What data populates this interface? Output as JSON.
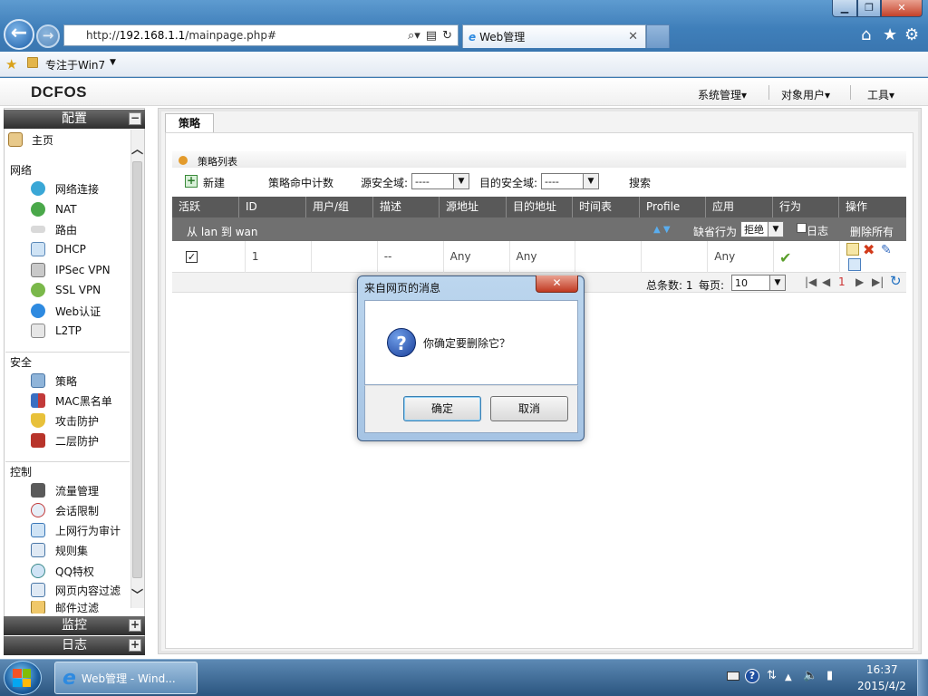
{
  "browser": {
    "address_prefix": "http://",
    "address_host": "192.168.1.1",
    "address_path": "/mainpage.php#",
    "tab_title": "Web管理",
    "favorites_label": "专注于Win7"
  },
  "app": {
    "logo": "DCFOS",
    "menus": [
      "系统管理▾",
      "对象用户▾",
      "工具▾"
    ]
  },
  "sidebar": {
    "config_header": "配置",
    "config_toggle": "−",
    "home": "主页",
    "sections": [
      {
        "title": "网络",
        "items": [
          "网络连接",
          "NAT",
          "路由",
          "DHCP",
          "IPSec VPN",
          "SSL VPN",
          "Web认证",
          "L2TP"
        ]
      },
      {
        "title": "安全",
        "items": [
          "策略",
          "MAC黑名单",
          "攻击防护",
          "二层防护"
        ]
      },
      {
        "title": "控制",
        "items": [
          "流量管理",
          "会话限制",
          "上网行为审计",
          "规则集",
          "QQ特权",
          "网页内容过滤",
          "邮件过滤"
        ]
      }
    ],
    "monitor_header": "监控",
    "log_header": "日志",
    "expand_toggle": "+"
  },
  "content": {
    "tab": "策略",
    "list_title": "策略列表",
    "toolbar": {
      "new_label": "新建",
      "hit_count": "策略命中计数",
      "src_zone_label": "源安全域:",
      "src_zone_value": "----",
      "dst_zone_label": "目的安全域:",
      "dst_zone_value": "----",
      "search_label": "搜索"
    },
    "columns": [
      "活跃",
      "ID",
      "用户/组",
      "描述",
      "源地址",
      "目的地址",
      "时间表",
      "Profile",
      "应用",
      "行为",
      "操作"
    ],
    "group_row": {
      "label": "从 lan 到 wan",
      "default_action_label": "缺省行为",
      "default_action_value": "拒绝",
      "log_label": "日志",
      "delete_all": "删除所有"
    },
    "rows": [
      {
        "active": true,
        "id": "1",
        "user": "",
        "desc": "--",
        "src": "Any",
        "dst": "Any",
        "schedule": "",
        "profile": "",
        "app": "Any",
        "action_icon": "check-icon"
      }
    ],
    "pager": {
      "total_label": "总条数: 1",
      "per_page_label": "每页:",
      "per_page_value": "10",
      "current_page": "1"
    }
  },
  "dialog": {
    "title": "来自网页的消息",
    "message": "你确定要删除它？",
    "ok": "确定",
    "cancel": "取消"
  },
  "taskbar": {
    "task_label": "Web管理 - Wind...",
    "time": "16:37",
    "date": "2015/4/2"
  }
}
